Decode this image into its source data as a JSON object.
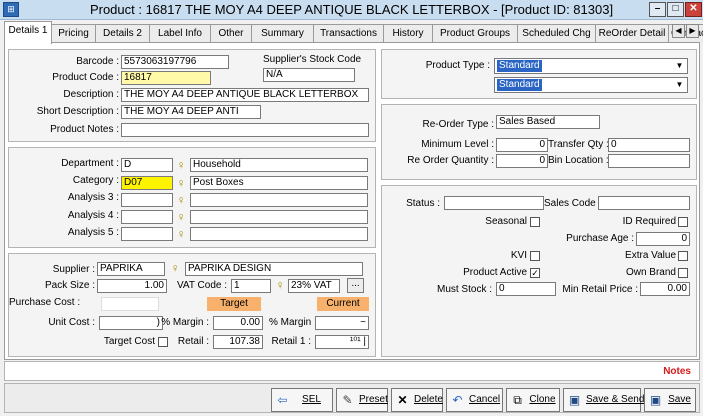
{
  "window": {
    "title": "Product : 16817 THE MOY A4 DEEP ANTIQUE BLACK LETTERBOX - [Product ID: 81303]",
    "minimize": "–",
    "maximize": "□",
    "close": "✕"
  },
  "tabs": [
    "Details 1",
    "Pricing",
    "Details 2",
    "Label Info",
    "Other",
    "Summary",
    "Transactions",
    "History",
    "Product Groups",
    "Scheduled Chg",
    "ReOrder Detail",
    "Contract"
  ],
  "tab_scroll": {
    "left": "◀",
    "right": "▶"
  },
  "details": {
    "barcode_label": "Barcode :",
    "barcode": "5573063197796",
    "supplier_stock_label": "Supplier's Stock Code",
    "supplier_stock": "N/A",
    "product_code_label": "Product Code :",
    "product_code": "16817",
    "description_label": "Description :",
    "description": "THE MOY A4 DEEP ANTIQUE BLACK LETTERBOX",
    "short_description_label": "Short Description :",
    "short_description": "THE MOY A4 DEEP ANTI",
    "product_notes_label": "Product Notes :",
    "product_notes": ""
  },
  "classification": {
    "department_label": "Department :",
    "department_code": "D",
    "department_name": "Household",
    "category_label": "Category :",
    "category_code": "D07",
    "category_name": "Post Boxes",
    "analysis3_label": "Analysis 3 :",
    "analysis4_label": "Analysis 4 :",
    "analysis5_label": "Analysis 5 :"
  },
  "supplier": {
    "supplier_label": "Supplier :",
    "supplier_code": "PAPRIKA",
    "supplier_name": "PAPRIKA DESIGN",
    "pack_size_label": "Pack Size :",
    "pack_size": "1.00",
    "vat_code_label": "VAT Code :",
    "vat_code": "1",
    "vat_desc": "23% VAT",
    "ellipsis": "...",
    "purchase_cost_label": "Purchase Cost :",
    "target_header": "Target",
    "current_header": "Current",
    "unit_cost_label": "Unit Cost :",
    "unit_cost": ")",
    "margin_label": "% Margin :",
    "target_margin": "0.00",
    "current_margin": "~",
    "target_cost_label": "Target Cost",
    "retail_label": "Retail :",
    "retail": "107.38",
    "retail1_label": "Retail 1 :",
    "retail1": "¹⁰¹ |"
  },
  "product_type": {
    "label": "Product Type :",
    "value1": "Standard",
    "value2": "Standard",
    "arrow": "▼"
  },
  "reorder": {
    "type_label": "Re-Order Type :",
    "type": "Sales Based",
    "min_level_label": "Minimum Level :",
    "min_level": "0",
    "transfer_qty_label": "Transfer Qty :",
    "transfer_qty": "0",
    "reorder_qty_label": "Re Order Quantity :",
    "reorder_qty": "0",
    "bin_location_label": "Bin Location :",
    "bin_location": ""
  },
  "status": {
    "status_label": "Status :",
    "status": "",
    "sales_code_label": "Sales Code :",
    "sales_code": "",
    "seasonal_label": "Seasonal",
    "id_required_label": "ID Required",
    "purchase_age_label": "Purchase Age :",
    "purchase_age": "0",
    "kvi_label": "KVI",
    "extra_value_label": "Extra Value",
    "product_active_label": "Product Active",
    "checkmark": "✓",
    "own_brand_label": "Own Brand",
    "must_stock_label": "Must Stock :",
    "must_stock": "0",
    "min_retail_label": "Min Retail Price :",
    "min_retail": "0.00"
  },
  "notes_label": "Notes",
  "buttons": [
    {
      "label": "SEL",
      "icon": "⇦"
    },
    {
      "label": "Preset",
      "icon": "✎"
    },
    {
      "label": "Delete",
      "icon": "✕"
    },
    {
      "label": "Cancel",
      "icon": "↶"
    },
    {
      "label": "Clone",
      "icon": "⧉"
    },
    {
      "label": "Save & Send",
      "icon": "▣"
    },
    {
      "label": "Save",
      "icon": "▣"
    }
  ],
  "colors": {
    "highlight": "#fff9a8",
    "highlight_strong": "#fff400",
    "orange": "#f7b16c",
    "notes": "#d21b1b",
    "selection": "#2a64c4"
  }
}
